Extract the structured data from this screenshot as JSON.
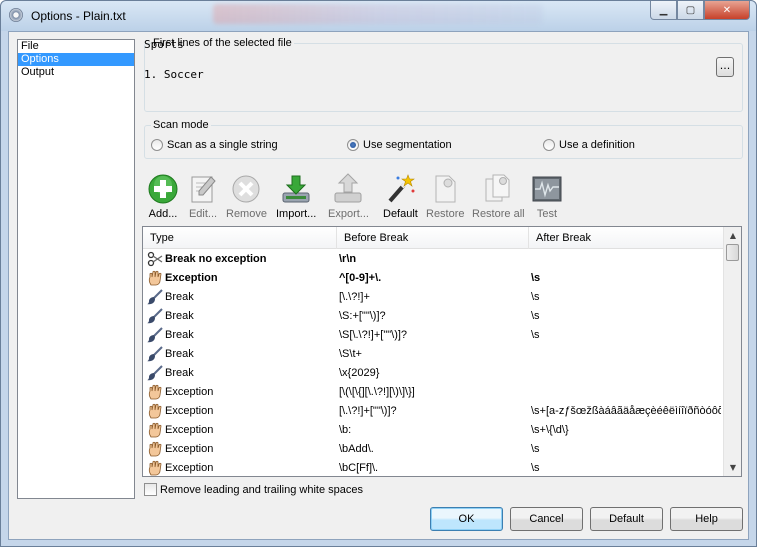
{
  "window": {
    "title": "Options - Plain.txt"
  },
  "nav": {
    "items": [
      "File",
      "Options",
      "Output"
    ],
    "selected": "Options"
  },
  "preview": {
    "legend": "First lines of the selected file",
    "lines": [
      "Sports",
      "",
      "1. Soccer"
    ],
    "browse_label": "..."
  },
  "scan_mode": {
    "legend": "Scan mode",
    "options": [
      "Scan as a single string",
      "Use segmentation",
      "Use a definition"
    ],
    "selected": "Use segmentation"
  },
  "toolbar": {
    "items": [
      {
        "label": "Add...",
        "icon": "add-icon",
        "enabled": true
      },
      {
        "label": "Edit...",
        "icon": "edit-icon",
        "enabled": false
      },
      {
        "label": "Remove",
        "icon": "remove-icon",
        "enabled": false
      },
      {
        "label": "Import...",
        "icon": "import-icon",
        "enabled": true
      },
      {
        "label": "Export...",
        "icon": "export-icon",
        "enabled": false
      },
      {
        "label": "Default",
        "icon": "magic-wand-icon",
        "enabled": true
      },
      {
        "label": "Restore",
        "icon": "restore-icon",
        "enabled": false
      },
      {
        "label": "Restore all",
        "icon": "restore-all-icon",
        "enabled": false
      },
      {
        "label": "Test",
        "icon": "test-icon",
        "enabled": false
      }
    ]
  },
  "rules_table": {
    "columns": [
      "Type",
      "Before Break",
      "After Break"
    ],
    "rows": [
      {
        "icon": "scissors-icon",
        "type": "Break no exception",
        "before": "\\r\\n",
        "after": "",
        "bold": true
      },
      {
        "icon": "hand-icon",
        "type": "Exception",
        "before": "^[0-9]+\\.",
        "after": "\\s",
        "bold": true
      },
      {
        "icon": "brush-icon",
        "type": "Break",
        "before": "[\\.\\?!]+",
        "after": "\\s",
        "bold": false
      },
      {
        "icon": "brush-icon",
        "type": "Break",
        "before": "\\S:+[\"\"\\)]?",
        "after": "\\s",
        "bold": false
      },
      {
        "icon": "brush-icon",
        "type": "Break",
        "before": "\\S[\\.\\?!]+[\"\"\\)]?",
        "after": "\\s",
        "bold": false
      },
      {
        "icon": "brush-icon",
        "type": "Break",
        "before": "\\S\\t+",
        "after": "",
        "bold": false
      },
      {
        "icon": "brush-icon",
        "type": "Break",
        "before": "\\x{2029}",
        "after": "",
        "bold": false
      },
      {
        "icon": "hand-icon",
        "type": "Exception",
        "before": "[\\(\\[\\{][\\.\\?!][\\)\\]\\}]",
        "after": "",
        "bold": false
      },
      {
        "icon": "hand-icon",
        "type": "Exception",
        "before": "[\\.\\?!]+[\"\"\\)]?",
        "after": "\\s+[a-zƒšœžßàáâãäåæçèéêëìíîïðñòóôõö",
        "bold": false
      },
      {
        "icon": "hand-icon",
        "type": "Exception",
        "before": "\\b:",
        "after": "\\s+\\{\\d\\}",
        "bold": false
      },
      {
        "icon": "hand-icon",
        "type": "Exception",
        "before": "\\bAdd\\.",
        "after": "\\s",
        "bold": false
      },
      {
        "icon": "hand-icon",
        "type": "Exception",
        "before": "\\bC[Ff]\\.",
        "after": "\\s",
        "bold": false
      }
    ]
  },
  "options": {
    "trim_label": "Remove leading and trailing white spaces",
    "trim_checked": false
  },
  "buttons": {
    "ok": "OK",
    "cancel": "Cancel",
    "default": "Default",
    "help": "Help"
  },
  "colors": {
    "selection": "#3399ff",
    "title_bar": "#c5d6ea",
    "dialog_bg": "#f0f0f0"
  }
}
